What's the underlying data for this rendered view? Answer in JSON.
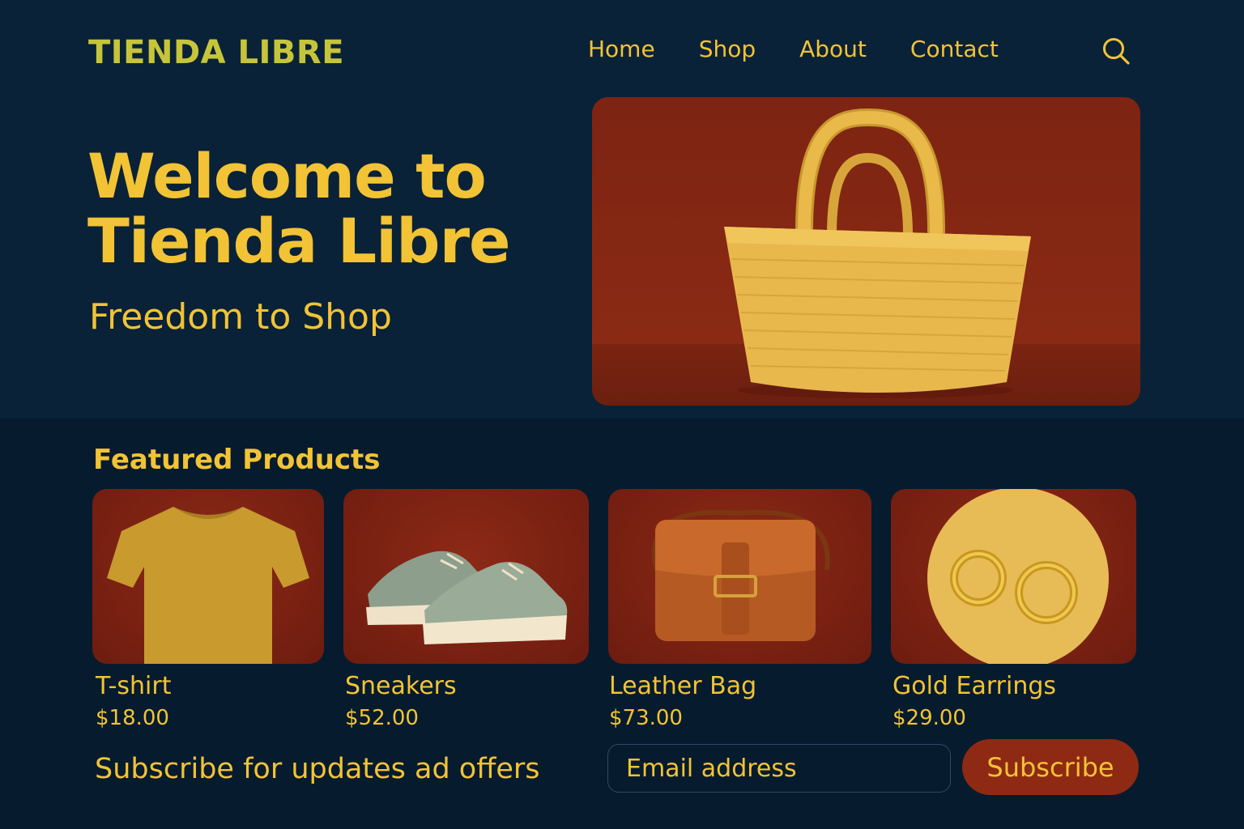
{
  "header": {
    "logo": "TIENDA LIBRE",
    "nav": [
      "Home",
      "Shop",
      "About",
      "Contact"
    ],
    "search_icon": "search-icon"
  },
  "hero": {
    "title_line1": "Welcome to",
    "title_line2": "Tienda Libre",
    "subtitle": "Freedom to Shop",
    "image": "woven-straw-tote-bag"
  },
  "featured": {
    "title": "Featured Products",
    "products": [
      {
        "name": "T-shirt",
        "price": "$18.00",
        "image": "mustard-tshirt"
      },
      {
        "name": "Sneakers",
        "price": "$52.00",
        "image": "sage-sneakers"
      },
      {
        "name": "Leather Bag",
        "price": "$73.00",
        "image": "tan-leather-crossbody-bag"
      },
      {
        "name": "Gold Earrings",
        "price": "$29.00",
        "image": "gold-hoop-earrings"
      }
    ]
  },
  "subscribe": {
    "text": "Subscribe for updates ad offers",
    "email_placeholder": "Email address",
    "button_label": "Subscribe"
  },
  "colors": {
    "background": "#0a2237",
    "accent": "#f2c335",
    "logo": "#c6c53a",
    "brand_red": "#8e2a13"
  }
}
